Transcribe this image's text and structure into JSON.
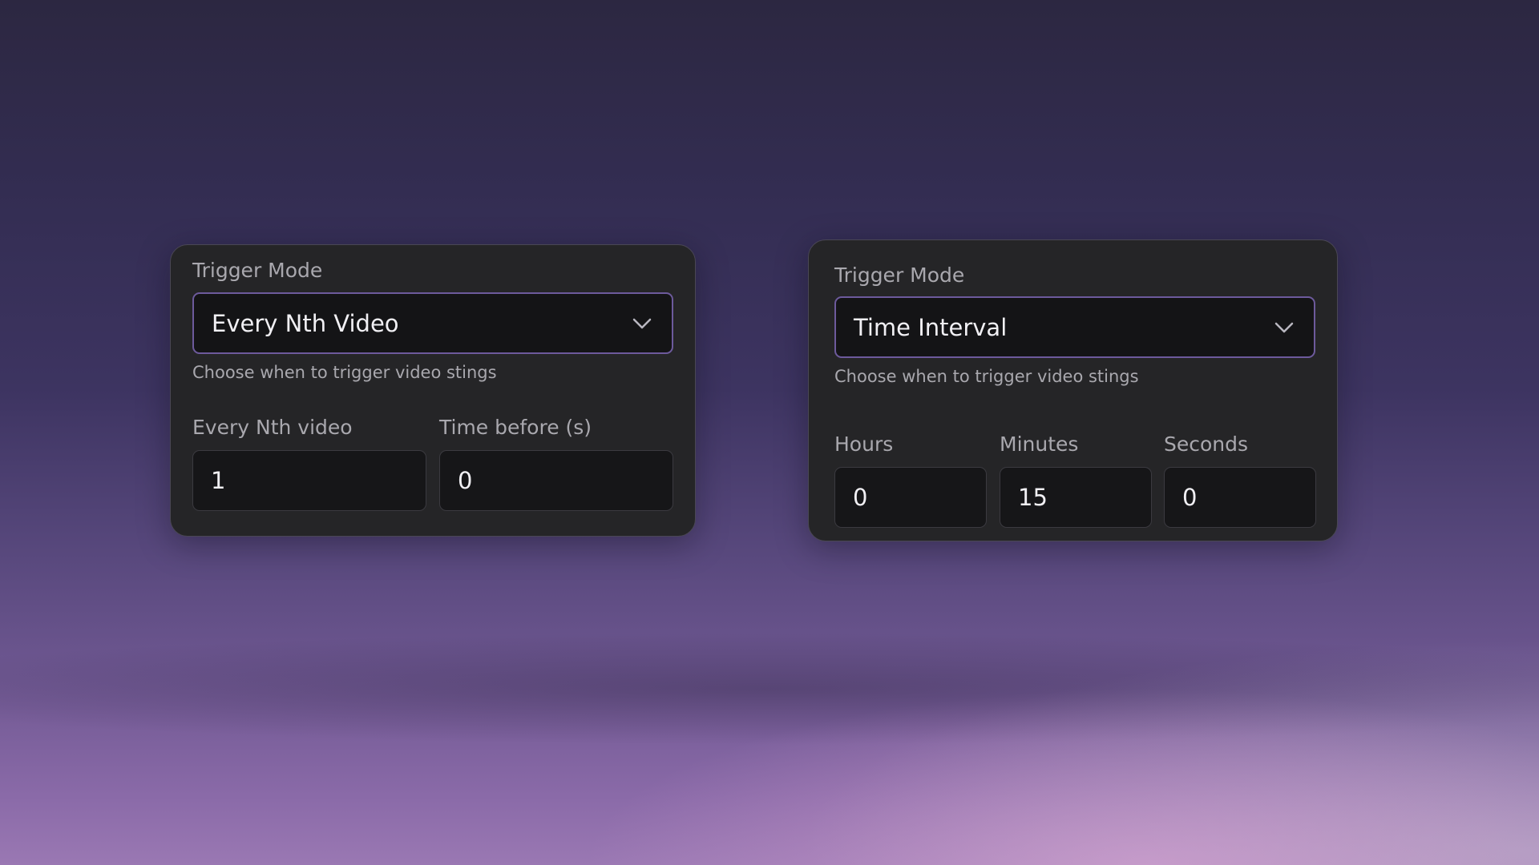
{
  "left_panel": {
    "trigger_label": "Trigger Mode",
    "trigger_value": "Every Nth Video",
    "trigger_help": "Choose when to trigger video stings",
    "fields": [
      {
        "label": "Every Nth video",
        "value": "1"
      },
      {
        "label": "Time before (s)",
        "value": "0"
      }
    ]
  },
  "right_panel": {
    "trigger_label": "Trigger Mode",
    "trigger_value": "Time Interval",
    "trigger_help": "Choose when to trigger video stings",
    "fields": [
      {
        "label": "Hours",
        "value": "0"
      },
      {
        "label": "Minutes",
        "value": "15"
      },
      {
        "label": "Seconds",
        "value": "0"
      }
    ]
  },
  "icons": {
    "dropdown": "chevron-down-icon"
  },
  "colors": {
    "card_background": "#252527",
    "select_border_accent": "#6d5a9c",
    "input_background": "#161618",
    "text_primary": "#f1f0f4",
    "text_secondary": "#a9a8ae"
  }
}
